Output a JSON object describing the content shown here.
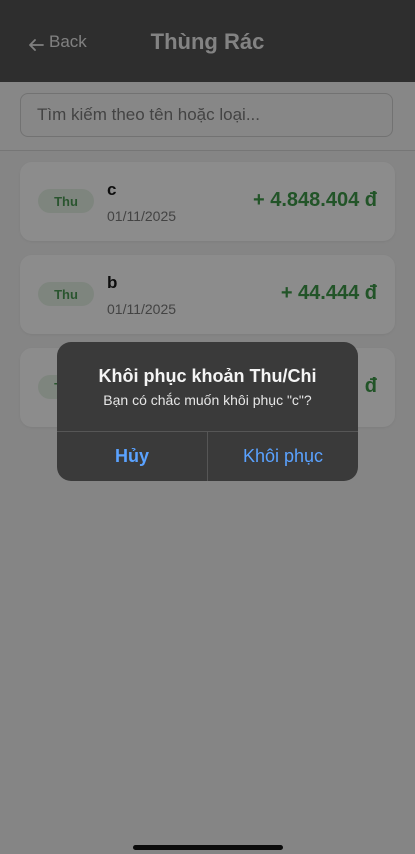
{
  "header": {
    "back_label": "Back",
    "title": "Thùng Rác"
  },
  "search": {
    "placeholder": "Tìm kiếm theo tên hoặc loại...",
    "value": ""
  },
  "transactions": [
    {
      "type": "Thu",
      "name": "c",
      "date": "01/11/2025",
      "amount": "+ 4.848.404 đ"
    },
    {
      "type": "Thu",
      "name": "b",
      "date": "01/11/2025",
      "amount": "+ 44.444 đ"
    },
    {
      "type": "Thu",
      "name": "",
      "date": "",
      "amount": "đ"
    }
  ],
  "dialog": {
    "title": "Khôi phục khoản Thu/Chi",
    "message": "Bạn có chắc muốn khôi phục \"c\"?",
    "cancel_label": "Hủy",
    "confirm_label": "Khôi phục"
  },
  "colors": {
    "header_bg": "#555555",
    "income_green": "#3e9a49",
    "dialog_bg": "#3a3a3a",
    "dialog_button": "#5aa2ff"
  },
  "icons": {
    "back": "arrow-left-icon"
  }
}
